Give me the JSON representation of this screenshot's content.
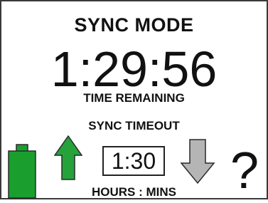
{
  "header": {
    "mode_title": "SYNC MODE"
  },
  "countdown": {
    "value": "1:29:56",
    "label": "TIME REMAINING"
  },
  "timeout": {
    "title": "SYNC TIMEOUT",
    "value": "1:30",
    "units": "HOURS : MINS"
  },
  "controls": {
    "battery_icon": "battery-full-icon",
    "increase_icon": "arrow-up-icon",
    "decrease_icon": "arrow-down-icon",
    "help_icon": "question-mark-icon",
    "help_glyph": "?"
  },
  "colors": {
    "battery": "#1a9f2f",
    "increase": "#25a23a",
    "decrease_disabled": "#b5b5b5",
    "outline": "#2a2a2a"
  }
}
